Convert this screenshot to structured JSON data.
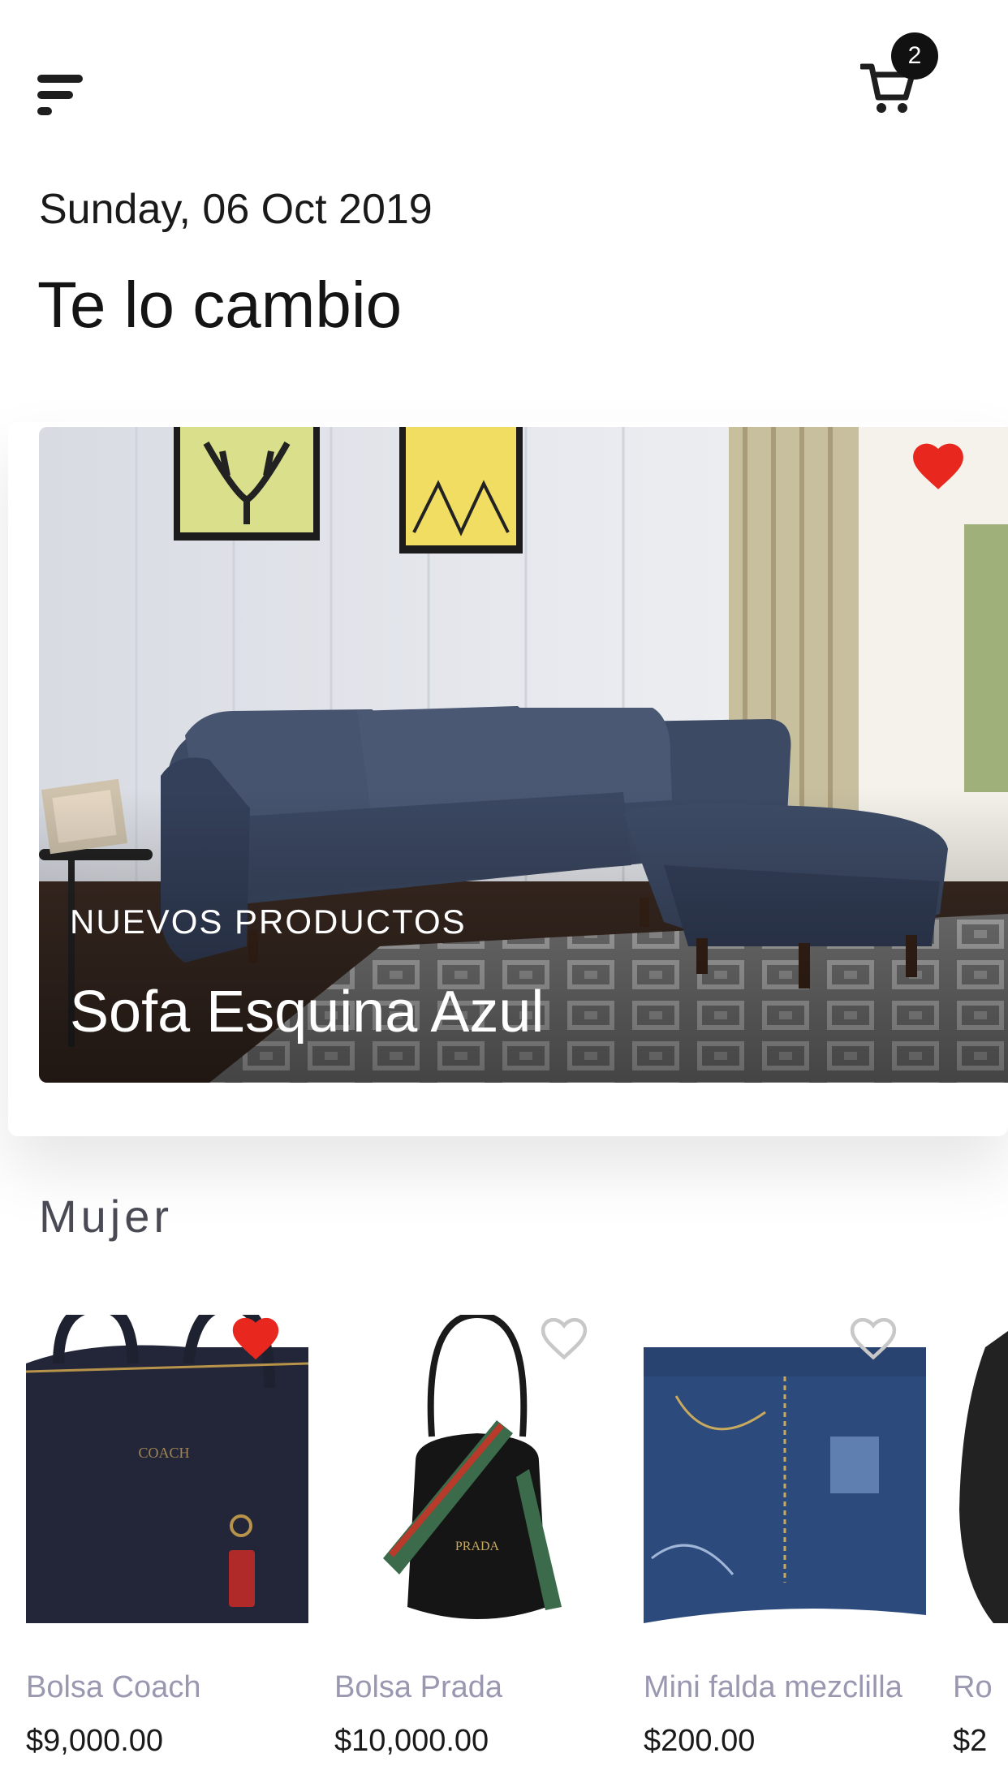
{
  "header": {
    "menu_icon": "menu-icon",
    "cart_icon": "cart-icon",
    "cart_count": "2"
  },
  "date": "Sunday, 06 Oct 2019",
  "title": "Te lo cambio",
  "featured": {
    "kicker": "NUEVOS PRODUCTOS",
    "name": "Sofa Esquina Azul",
    "favorited": true
  },
  "section": {
    "title": "Mujer",
    "products": [
      {
        "name": "Bolsa Coach",
        "price": "$9,000.00",
        "favorited": true
      },
      {
        "name": "Bolsa Prada",
        "price": "$10,000.00",
        "favorited": false
      },
      {
        "name": "Mini falda mezclilla",
        "price": "$200.00",
        "favorited": false
      },
      {
        "name": "Ro",
        "price": "$2",
        "favorited": false
      }
    ]
  },
  "colors": {
    "heart_active": "#e8271f",
    "heart_inactive": "#c8c8c8",
    "badge": "#111111"
  }
}
